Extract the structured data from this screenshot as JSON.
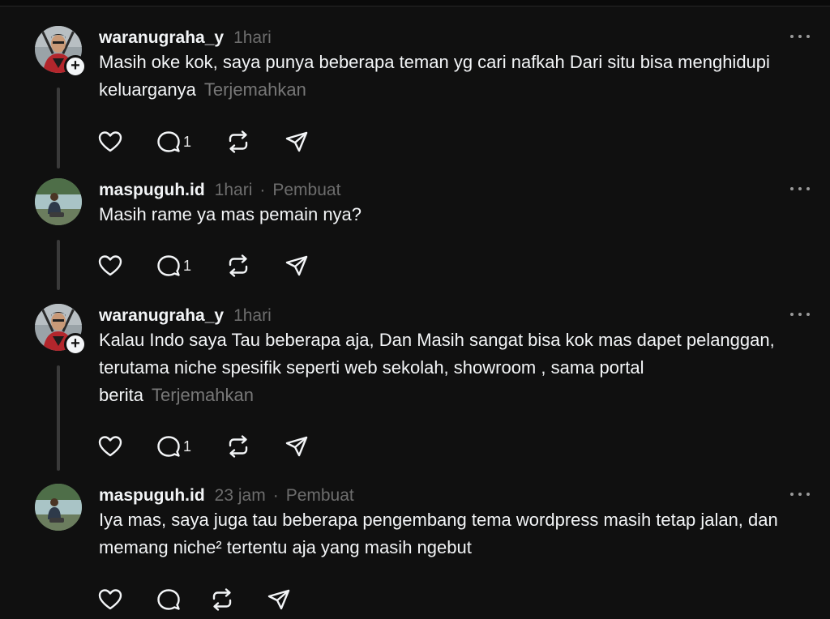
{
  "posts": [
    {
      "username": "waranugraha_y",
      "time": "1hari",
      "role": "",
      "text": "Masih oke kok, saya punya beberapa teman yg cari nafkah Dari situ bisa menghidupi keluarganya",
      "translate": "Terjemahkan",
      "reply_count": "1",
      "avatar_icon": "avatar-deadpool",
      "follow_icon": "plus-icon"
    },
    {
      "username": "maspuguh.id",
      "time": "1hari",
      "separator": "·",
      "role": "Pembuat",
      "text": "Masih rame ya mas pemain nya?",
      "translate": "",
      "reply_count": "1",
      "avatar_icon": "avatar-photo"
    },
    {
      "username": "waranugraha_y",
      "time": "1hari",
      "role": "",
      "text": "Kalau Indo saya Tau beberapa aja, Dan Masih sangat bisa kok mas dapet pelanggan, terutama niche spesifik seperti web sekolah, showroom , sama portal berita",
      "translate": "Terjemahkan",
      "reply_count": "1",
      "avatar_icon": "avatar-deadpool",
      "follow_icon": "plus-icon"
    },
    {
      "username": "maspuguh.id",
      "time": "23 jam",
      "separator": "·",
      "role": "Pembuat",
      "text": "Iya mas, saya juga tau beberapa pengembang tema wordpress masih tetap jalan, dan memang niche² tertentu aja yang masih ngebut",
      "translate": "",
      "reply_count": "",
      "avatar_icon": "avatar-photo"
    }
  ],
  "colors": {
    "background": "#101010",
    "text": "#f3f5f7",
    "muted": "#6d6d6d",
    "thread_line": "#3a3a3a"
  }
}
